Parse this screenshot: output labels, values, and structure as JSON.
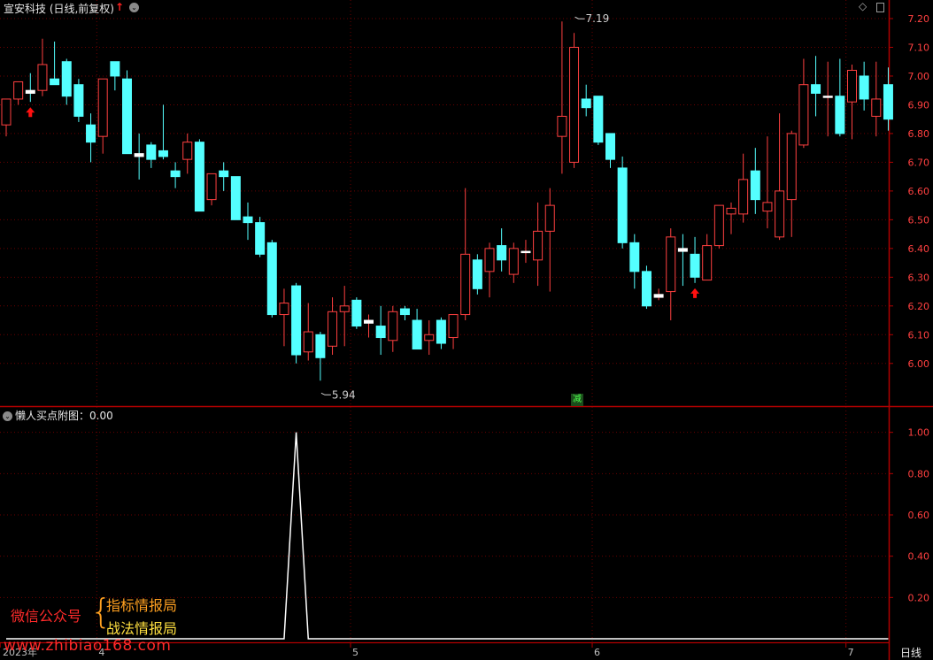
{
  "header": {
    "title": "宣安科技 (日线,前复权)"
  },
  "icons": {
    "up_arrow": "↑",
    "dropdown": "⌄"
  },
  "sub_panel": {
    "title": "懒人买点附图：0.00"
  },
  "period_label": "日线",
  "badge_text": "减",
  "watermark": {
    "label": "微信公众号",
    "brace": "{",
    "line1": "指标情报局",
    "line2": "战法情报局",
    "url": "www.zhibiao168.com"
  },
  "colors": {
    "up": "#ff4040",
    "down": "#54ffff",
    "border": "#b00000",
    "grid": "#6a0000",
    "signal": "#ff1010",
    "line": "#ffffff"
  },
  "chart_data": [
    {
      "type": "candlestick",
      "ylim": [
        5.87,
        7.24
      ],
      "y_ticks": [
        6.0,
        6.1,
        6.2,
        6.3,
        6.4,
        6.5,
        6.6,
        6.7,
        6.8,
        6.9,
        7.0,
        7.1,
        7.2
      ],
      "x_ticks": [
        {
          "label": "2023年",
          "index": 0
        },
        {
          "label": "4",
          "index": 8
        },
        {
          "label": "5",
          "index": 29
        },
        {
          "label": "6",
          "index": 49
        },
        {
          "label": "7",
          "index": 70
        }
      ],
      "annotations": [
        {
          "text": "7.19",
          "index": 47,
          "value": 7.19,
          "kind": "high"
        },
        {
          "text": "5.94",
          "index": 26,
          "value": 5.94,
          "kind": "low"
        }
      ],
      "signals": [
        2,
        57
      ],
      "candles": [
        [
          6.83,
          6.92,
          6.79,
          6.92
        ],
        [
          6.92,
          6.98,
          6.9,
          6.98
        ],
        [
          6.95,
          7.01,
          6.91,
          6.94
        ],
        [
          6.95,
          7.13,
          6.93,
          7.04
        ],
        [
          6.99,
          7.12,
          6.98,
          6.97
        ],
        [
          7.05,
          7.06,
          6.9,
          6.93
        ],
        [
          6.97,
          6.99,
          6.84,
          6.86
        ],
        [
          6.83,
          6.87,
          6.7,
          6.77
        ],
        [
          6.79,
          6.99,
          6.73,
          6.99
        ],
        [
          7.05,
          7.05,
          6.95,
          7.0
        ],
        [
          6.99,
          7.02,
          6.77,
          6.73
        ],
        [
          6.73,
          6.8,
          6.64,
          6.72
        ],
        [
          6.76,
          6.77,
          6.68,
          6.71
        ],
        [
          6.74,
          6.9,
          6.71,
          6.72
        ],
        [
          6.67,
          6.7,
          6.61,
          6.65
        ],
        [
          6.71,
          6.8,
          6.66,
          6.77
        ],
        [
          6.77,
          6.78,
          6.53,
          6.53
        ],
        [
          6.57,
          6.66,
          6.55,
          6.66
        ],
        [
          6.67,
          6.7,
          6.6,
          6.65
        ],
        [
          6.65,
          6.65,
          6.5,
          6.5
        ],
        [
          6.51,
          6.56,
          6.43,
          6.49
        ],
        [
          6.49,
          6.51,
          6.37,
          6.38
        ],
        [
          6.42,
          6.43,
          6.16,
          6.17
        ],
        [
          6.17,
          6.26,
          6.06,
          6.21
        ],
        [
          6.27,
          6.28,
          6.0,
          6.03
        ],
        [
          6.04,
          6.21,
          6.01,
          6.11
        ],
        [
          6.1,
          6.11,
          5.94,
          6.02
        ],
        [
          6.06,
          6.23,
          6.03,
          6.18
        ],
        [
          6.18,
          6.27,
          6.06,
          6.2
        ],
        [
          6.22,
          6.23,
          6.12,
          6.13
        ],
        [
          6.14,
          6.17,
          6.09,
          6.15
        ],
        [
          6.13,
          6.2,
          6.03,
          6.09
        ],
        [
          6.08,
          6.2,
          6.04,
          6.18
        ],
        [
          6.19,
          6.2,
          6.15,
          6.17
        ],
        [
          6.15,
          6.19,
          6.06,
          6.05
        ],
        [
          6.08,
          6.15,
          6.03,
          6.1
        ],
        [
          6.15,
          6.16,
          6.05,
          6.07
        ],
        [
          6.09,
          6.16,
          6.05,
          6.17
        ],
        [
          6.17,
          6.61,
          6.15,
          6.38
        ],
        [
          6.36,
          6.38,
          6.24,
          6.26
        ],
        [
          6.32,
          6.42,
          6.23,
          6.4
        ],
        [
          6.41,
          6.47,
          6.32,
          6.36
        ],
        [
          6.31,
          6.42,
          6.28,
          6.4
        ],
        [
          6.39,
          6.43,
          6.35,
          6.39
        ],
        [
          6.36,
          6.56,
          6.27,
          6.46
        ],
        [
          6.46,
          6.61,
          6.25,
          6.55
        ],
        [
          6.79,
          7.19,
          6.66,
          6.86
        ],
        [
          6.7,
          7.15,
          6.68,
          7.1
        ],
        [
          6.92,
          6.97,
          6.86,
          6.89
        ],
        [
          6.93,
          6.93,
          6.76,
          6.77
        ],
        [
          6.8,
          6.8,
          6.68,
          6.71
        ],
        [
          6.68,
          6.72,
          6.4,
          6.42
        ],
        [
          6.42,
          6.45,
          6.26,
          6.32
        ],
        [
          6.32,
          6.34,
          6.19,
          6.2
        ],
        [
          6.23,
          6.26,
          6.22,
          6.24
        ],
        [
          6.25,
          6.47,
          6.15,
          6.44
        ],
        [
          6.4,
          6.45,
          6.27,
          6.39
        ],
        [
          6.38,
          6.44,
          6.28,
          6.3
        ],
        [
          6.29,
          6.45,
          6.29,
          6.41
        ],
        [
          6.41,
          6.51,
          6.4,
          6.55
        ],
        [
          6.52,
          6.56,
          6.45,
          6.54
        ],
        [
          6.52,
          6.73,
          6.49,
          6.64
        ],
        [
          6.67,
          6.75,
          6.52,
          6.57
        ],
        [
          6.53,
          6.79,
          6.47,
          6.56
        ],
        [
          6.44,
          6.87,
          6.43,
          6.6
        ],
        [
          6.57,
          6.81,
          6.44,
          6.8
        ],
        [
          6.76,
          7.06,
          6.75,
          6.97
        ],
        [
          6.97,
          7.07,
          6.86,
          6.94
        ],
        [
          6.93,
          7.05,
          6.79,
          6.93
        ],
        [
          6.93,
          7.06,
          6.79,
          6.8
        ],
        [
          6.91,
          7.04,
          6.78,
          7.02
        ],
        [
          7.0,
          7.05,
          6.88,
          6.92
        ],
        [
          6.86,
          7.05,
          6.79,
          6.92
        ],
        [
          6.97,
          7.03,
          6.81,
          6.85
        ]
      ]
    },
    {
      "type": "line",
      "title": "懒人买点附图",
      "ylim": [
        0,
        1.08
      ],
      "y_ticks": [
        0.2,
        0.4,
        0.6,
        0.8,
        1.0
      ],
      "series": [
        {
          "values": [
            0,
            0,
            0,
            0,
            0,
            0,
            0,
            0,
            0,
            0,
            0,
            0,
            0,
            0,
            0,
            0,
            0,
            0,
            0,
            0,
            0,
            0,
            0,
            0,
            1,
            0,
            0,
            0,
            0,
            0,
            0,
            0,
            0,
            0,
            0,
            0,
            0,
            0,
            0,
            0,
            0,
            0,
            0,
            0,
            0,
            0,
            0,
            0,
            0,
            0,
            0,
            0,
            0,
            0,
            0,
            0,
            0,
            0,
            0,
            0,
            0,
            0,
            0,
            0,
            0,
            0,
            0,
            0,
            0,
            0,
            0,
            0,
            0,
            0
          ]
        }
      ]
    }
  ]
}
